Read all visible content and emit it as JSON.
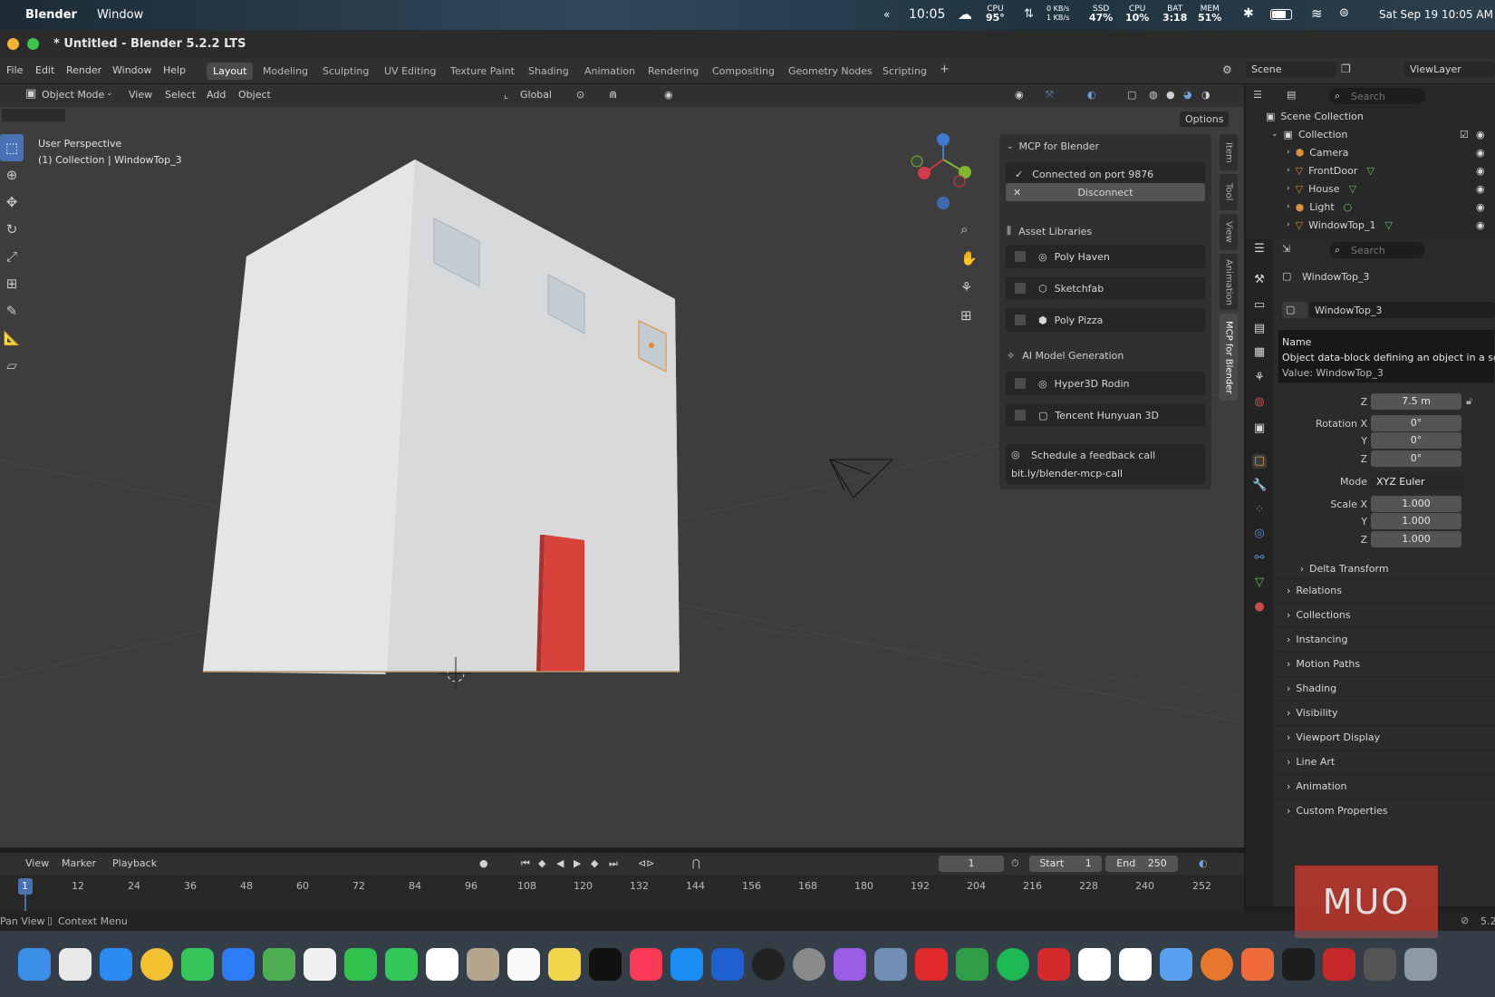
{
  "macos": {
    "app_name": "Blender",
    "menu_window": "Window",
    "time": "10:05",
    "cpu_temp_label": "CPU",
    "cpu_temp": "95°",
    "net_up": "0 KB/s",
    "net_down": "1 KB/s",
    "ssd_label": "SSD",
    "ssd": "47%",
    "cpu_label": "CPU",
    "cpu": "10%",
    "bat_label": "BAT",
    "bat": "3:18",
    "mem_label": "MEM",
    "mem": "51%",
    "datetime": "Sat Sep 19  10:05 AM"
  },
  "window": {
    "title": "* Untitled - Blender 5.2.2 LTS"
  },
  "menu": [
    "File",
    "Edit",
    "Render",
    "Window",
    "Help"
  ],
  "workspaces": [
    "Layout",
    "Modeling",
    "Sculpting",
    "UV Editing",
    "Texture Paint",
    "Shading",
    "Animation",
    "Rendering",
    "Compositing",
    "Geometry Nodes",
    "Scripting",
    "+"
  ],
  "scene": {
    "label": "Scene",
    "viewlayer": "ViewLayer"
  },
  "header": {
    "mode": "Object Mode",
    "view": "View",
    "select": "Select",
    "add": "Add",
    "object": "Object",
    "orientation": "Global",
    "options": "Options"
  },
  "viewport": {
    "perspective": "User Perspective",
    "context": "(1) Collection | WindowTop_3"
  },
  "mcp": {
    "title": "MCP for Blender",
    "status": "Connected on port 9876",
    "disconnect": "Disconnect",
    "asset_libraries": "Asset Libraries",
    "libraries": [
      "Poly Haven",
      "Sketchfab",
      "Poly Pizza"
    ],
    "ai_section": "AI Model Generation",
    "ai_tools": [
      "Hyper3D Rodin",
      "Tencent Hunyuan 3D"
    ],
    "feedback": "Schedule a feedback call",
    "feedback_link": "bit.ly/blender-mcp-call"
  },
  "side_tabs": [
    "Item",
    "Tool",
    "View",
    "Animation",
    "MCP for Blender"
  ],
  "outliner": {
    "search_placeholder": "Search",
    "scene_collection": "Scene Collection",
    "collection": "Collection",
    "items": [
      "Camera",
      "FrontDoor",
      "House",
      "Light",
      "WindowTop_1"
    ]
  },
  "properties": {
    "search_placeholder": "Search",
    "object_name": "WindowTop_3",
    "datablock": "WindowTop_3",
    "tooltip_title": "Name",
    "tooltip_desc": "Object data-block defining an object in a scene.",
    "tooltip_value": "Value: WindowTop_3",
    "loc_z_label": "Z",
    "loc_z": "7.5 m",
    "rot_label": "Rotation X",
    "rot_x": "0°",
    "rot_y_label": "Y",
    "rot_y": "0°",
    "rot_z_label": "Z",
    "rot_z": "0°",
    "mode_label": "Mode",
    "mode": "XYZ Euler",
    "scale_label": "Scale X",
    "scale_x": "1.000",
    "scale_y_label": "Y",
    "scale_y": "1.000",
    "scale_z_label": "Z",
    "scale_z": "1.000",
    "delta": "Delta Transform",
    "sections": [
      "Relations",
      "Collections",
      "Instancing",
      "Motion Paths",
      "Shading",
      "Visibility",
      "Viewport Display",
      "Line Art",
      "Animation",
      "Custom Properties"
    ]
  },
  "timeline": {
    "view": "View",
    "marker": "Marker",
    "playback": "Playback",
    "current_frame": "1",
    "start_label": "Start",
    "start": "1",
    "end_label": "End",
    "end": "250",
    "ticks": [
      "1",
      "12",
      "24",
      "36",
      "48",
      "60",
      "72",
      "84",
      "96",
      "108",
      "120",
      "132",
      "144",
      "156",
      "168",
      "180",
      "192",
      "204",
      "216",
      "228",
      "240",
      "252"
    ]
  },
  "status": {
    "pan": "Pan View",
    "context": "Context Menu",
    "version": "5.2"
  },
  "watermark": "MUO",
  "colors": {
    "accent": "#4772b3",
    "door": "#d9423a",
    "wall": "#c9ccd0",
    "muo": "#c0392b"
  }
}
